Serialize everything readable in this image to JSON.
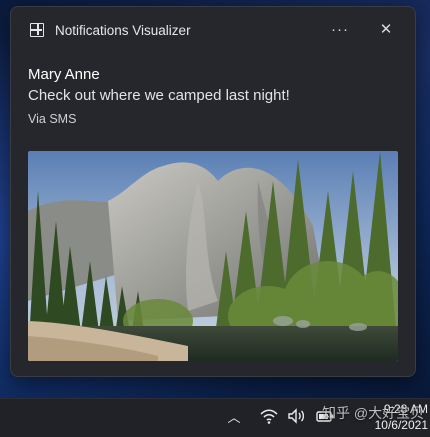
{
  "notification": {
    "app_name": "Notifications Visualizer",
    "app_icon": "app-logo-icon",
    "more_label": "···",
    "close_label": "✕",
    "sender": "Mary Anne",
    "message": "Check out where we camped last night!",
    "attribution": "Via SMS",
    "hero_image": "mountain-valley-photo"
  },
  "taskbar": {
    "chevron_label": "︿",
    "wifi_icon": "wifi-icon",
    "volume_icon": "volume-icon",
    "battery_icon": "battery-icon",
    "time": "9:28 AM",
    "date": "10/6/2021"
  },
  "watermark": "知乎 @大好宝贝",
  "colors": {
    "toast_bg": "#25272d",
    "taskbar_bg": "#202228",
    "desktop_accent": "#1a2f66"
  }
}
